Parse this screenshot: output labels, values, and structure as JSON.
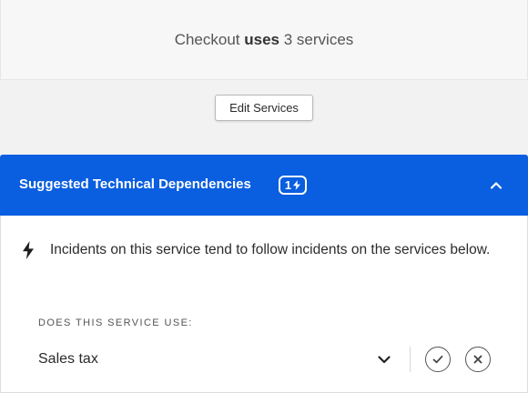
{
  "summary": {
    "service_name": "Checkout",
    "verb": "uses",
    "count_text": "3 services"
  },
  "edit_button": {
    "label": "Edit Services"
  },
  "dependencies": {
    "title": "Suggested Technical Dependencies",
    "badge_count": "1",
    "info_text": "Incidents on this service tend to follow incidents on the services below.",
    "question_label": "DOES THIS SERVICE USE:",
    "suggested_service": "Sales tax"
  },
  "colors": {
    "accent": "#0a5ee0",
    "header_text": "#ffffff",
    "page_bg": "#f2f2f2"
  },
  "icons": [
    "bolt-icon",
    "chevron-up-icon",
    "chevron-down-icon",
    "check-icon",
    "close-icon"
  ]
}
